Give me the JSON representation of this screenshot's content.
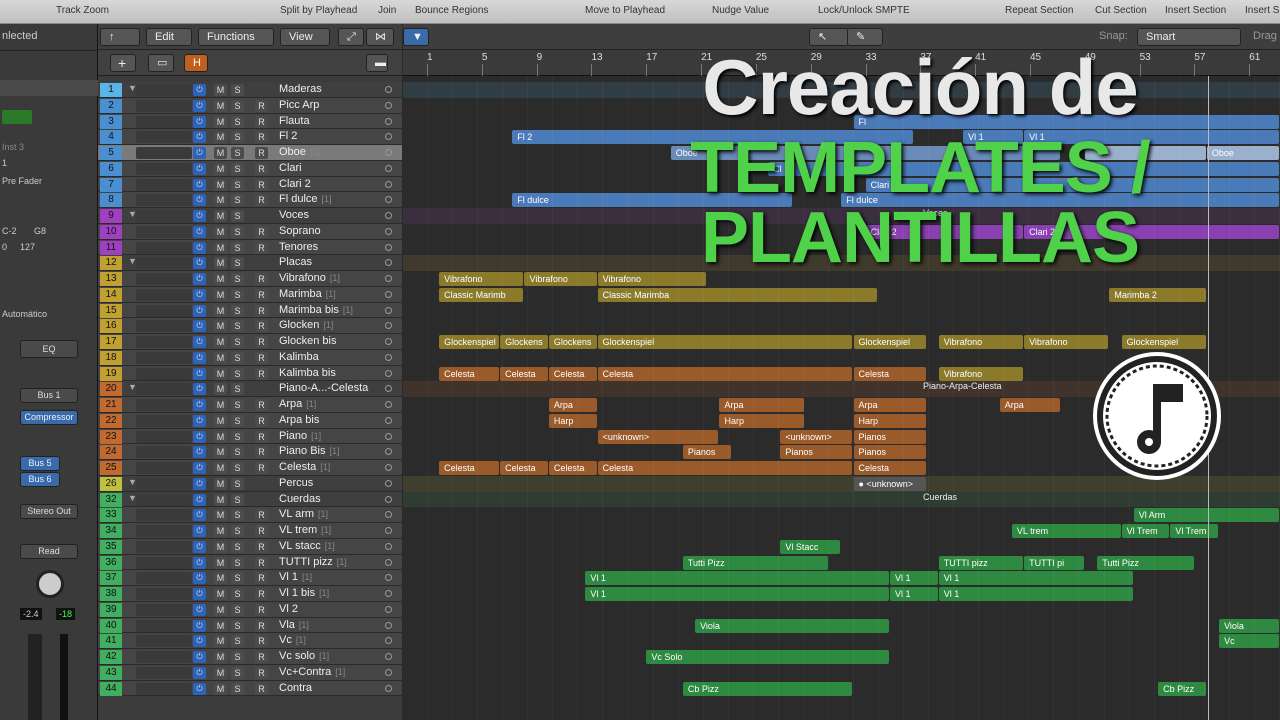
{
  "topbar": [
    "Track Zoom",
    "Split by Playhead",
    "Join",
    "Bounce Regions",
    "Move to Playhead",
    "Nudge Value",
    "Lock/Unlock SMPTE",
    "Repeat Section",
    "Cut Section",
    "Insert Section",
    "Insert Si"
  ],
  "inspector": {
    "selected": "nlected",
    "inst": "Inst 3",
    "fader": "Pre Fader",
    "key_lo": "C-2",
    "key_hi": "G8",
    "vel_lo": "0",
    "vel_hi": "127",
    "auto": "Automático",
    "eq": "EQ",
    "bus1": "Bus 1",
    "compressor": "Compressor",
    "bus5": "Bus 5",
    "bus6": "Bus 6",
    "stereo": "Stereo Out",
    "read": "Read",
    "val1": "-2.4",
    "val2": "-18"
  },
  "toolbar": {
    "edit": "Edit",
    "functions": "Functions",
    "view": "View",
    "snap_label": "Snap:",
    "snap_value": "Smart",
    "drag": "Drag"
  },
  "ruler": [
    "1",
    "5",
    "9",
    "13",
    "17",
    "21",
    "25",
    "29",
    "33",
    "37",
    "41",
    "45",
    "49",
    "53",
    "57",
    "61"
  ],
  "tracks": [
    {
      "n": "1",
      "name": "Maderas",
      "folder": true,
      "color": "#5ab4e6"
    },
    {
      "n": "2",
      "name": "Picc Arp",
      "color": "#4a90d0"
    },
    {
      "n": "3",
      "name": "Flauta",
      "color": "#4a90d0"
    },
    {
      "n": "4",
      "name": "Fl 2",
      "color": "#4a90d0"
    },
    {
      "n": "5",
      "name": "Oboe",
      "cnt": "[1]",
      "color": "#4a90d0",
      "sel": true
    },
    {
      "n": "6",
      "name": "Clari",
      "color": "#4a90d0"
    },
    {
      "n": "7",
      "name": "Clari 2",
      "color": "#4a90d0"
    },
    {
      "n": "8",
      "name": "Fl dulce",
      "cnt": "[1]",
      "color": "#4a90d0"
    },
    {
      "n": "9",
      "name": "Voces",
      "folder": true,
      "color": "#a040c0"
    },
    {
      "n": "10",
      "name": "Soprano",
      "color": "#a040c0"
    },
    {
      "n": "11",
      "name": "Tenores",
      "color": "#a040c0"
    },
    {
      "n": "12",
      "name": "Placas",
      "folder": true,
      "color": "#c0a030"
    },
    {
      "n": "13",
      "name": "Vibrafono",
      "cnt": "[1]",
      "color": "#c0a030"
    },
    {
      "n": "14",
      "name": "Marimba",
      "cnt": "[1]",
      "color": "#c0a030"
    },
    {
      "n": "15",
      "name": "Marimba bis",
      "cnt": "[1]",
      "color": "#c0a030"
    },
    {
      "n": "16",
      "name": "Glocken",
      "cnt": "[1]",
      "color": "#c0a030"
    },
    {
      "n": "17",
      "name": "Glocken bis",
      "color": "#c0a030"
    },
    {
      "n": "18",
      "name": "Kalimba",
      "color": "#c0a030"
    },
    {
      "n": "19",
      "name": "Kalimba bis",
      "color": "#c0a030"
    },
    {
      "n": "20",
      "name": "Piano-A...-Celesta",
      "folder": true,
      "color": "#c06a30"
    },
    {
      "n": "21",
      "name": "Arpa",
      "cnt": "[1]",
      "color": "#c06a30"
    },
    {
      "n": "22",
      "name": "Arpa bis",
      "color": "#c06a30"
    },
    {
      "n": "23",
      "name": "Piano",
      "cnt": "[1]",
      "color": "#c06a30"
    },
    {
      "n": "24",
      "name": "Piano Bis",
      "cnt": "[1]",
      "color": "#c06a30"
    },
    {
      "n": "25",
      "name": "Celesta",
      "cnt": "[1]",
      "color": "#c06a30"
    },
    {
      "n": "26",
      "name": "Percus",
      "folder": true,
      "color": "#c0c040"
    },
    {
      "n": "32",
      "name": "Cuerdas",
      "folder": true,
      "color": "#40b060"
    },
    {
      "n": "33",
      "name": "VL arm",
      "cnt": "[1]",
      "color": "#40b060"
    },
    {
      "n": "34",
      "name": "VL trem",
      "cnt": "[1]",
      "color": "#40b060"
    },
    {
      "n": "35",
      "name": "VL stacc",
      "cnt": "[1]",
      "color": "#40b060"
    },
    {
      "n": "36",
      "name": "TUTTI pizz",
      "cnt": "[1]",
      "color": "#40b060"
    },
    {
      "n": "37",
      "name": "Vl 1",
      "cnt": "[1]",
      "color": "#40b060"
    },
    {
      "n": "38",
      "name": "Vl 1 bis",
      "cnt": "[1]",
      "color": "#40b060"
    },
    {
      "n": "39",
      "name": "Vl 2",
      "color": "#40b060"
    },
    {
      "n": "40",
      "name": "Vla",
      "cnt": "[1]",
      "color": "#40b060"
    },
    {
      "n": "41",
      "name": "Vc",
      "cnt": "[1]",
      "color": "#40b060"
    },
    {
      "n": "42",
      "name": "Vc solo",
      "cnt": "[1]",
      "color": "#40b060"
    },
    {
      "n": "43",
      "name": "Vc+Contra",
      "cnt": "[1]",
      "color": "#40b060"
    },
    {
      "n": "44",
      "name": "Contra",
      "color": "#40b060"
    }
  ],
  "regions": [
    {
      "row": 2,
      "s": 35,
      "e": 70,
      "label": "Fl",
      "c": "#4a7ab8"
    },
    {
      "row": 3,
      "s": 7,
      "e": 40,
      "label": "Fl 2",
      "c": "#4a7ab8"
    },
    {
      "row": 3,
      "s": 44,
      "e": 49,
      "label": "Vl 1",
      "c": "#4a7ab8"
    },
    {
      "row": 3,
      "s": 49,
      "e": 70,
      "label": "Vl 1",
      "c": "#4a7ab8"
    },
    {
      "row": 4,
      "s": 20,
      "e": 52,
      "label": "Oboe",
      "c": "#6a8ab8"
    },
    {
      "row": 4,
      "s": 54,
      "e": 64,
      "label": "",
      "c": "#9ab0cc"
    },
    {
      "row": 4,
      "s": 64,
      "e": 70,
      "label": "Oboe",
      "c": "#9ab0cc"
    },
    {
      "row": 5,
      "s": 28,
      "e": 70,
      "label": "Cl",
      "c": "#4a7ab8"
    },
    {
      "row": 6,
      "s": 36,
      "e": 70,
      "label": "Clari 2",
      "c": "#4a7ab8"
    },
    {
      "row": 7,
      "s": 7,
      "e": 30,
      "label": "Fl dulce",
      "c": "#4a7ab8"
    },
    {
      "row": 7,
      "s": 34,
      "e": 70,
      "label": "Fl dulce",
      "c": "#4a7ab8"
    },
    {
      "row": 9,
      "s": 36,
      "e": 49,
      "label": "Clari 2",
      "c": "#8a40b0"
    },
    {
      "row": 9,
      "s": 49,
      "e": 70,
      "label": "Clari 2",
      "c": "#8a40b0"
    },
    {
      "row": 12,
      "s": 1,
      "e": 8,
      "label": "Vibrafono",
      "c": "#8a7a2a"
    },
    {
      "row": 12,
      "s": 8,
      "e": 14,
      "label": "Vibrafono",
      "c": "#8a7a2a"
    },
    {
      "row": 12,
      "s": 14,
      "e": 23,
      "label": "Vibrafono",
      "c": "#8a7a2a"
    },
    {
      "row": 13,
      "s": 1,
      "e": 8,
      "label": "Classic Marimb",
      "c": "#8a7a2a"
    },
    {
      "row": 13,
      "s": 14,
      "e": 37,
      "label": "Classic Marimba",
      "c": "#8a7a2a"
    },
    {
      "row": 13,
      "s": 56,
      "e": 64,
      "label": "Marimba 2",
      "c": "#8a7a2a"
    },
    {
      "row": 16,
      "s": 1,
      "e": 6,
      "label": "Glockenspiel",
      "c": "#8a7a2a"
    },
    {
      "row": 16,
      "s": 6,
      "e": 10,
      "label": "Glockens",
      "c": "#8a7a2a"
    },
    {
      "row": 16,
      "s": 10,
      "e": 14,
      "label": "Glockens",
      "c": "#8a7a2a"
    },
    {
      "row": 16,
      "s": 14,
      "e": 35,
      "label": "Glockenspiel",
      "c": "#8a7a2a"
    },
    {
      "row": 16,
      "s": 35,
      "e": 41,
      "label": "Glockenspiel",
      "c": "#8a7a2a"
    },
    {
      "row": 16,
      "s": 42,
      "e": 49,
      "label": "Vibrafono",
      "c": "#8a7a2a"
    },
    {
      "row": 16,
      "s": 49,
      "e": 56,
      "label": "Vibrafono",
      "c": "#8a7a2a"
    },
    {
      "row": 16,
      "s": 57,
      "e": 64,
      "label": "Glockenspiel",
      "c": "#8a7a2a"
    },
    {
      "row": 18,
      "s": 1,
      "e": 6,
      "label": "Celesta",
      "c": "#9a5a2a"
    },
    {
      "row": 18,
      "s": 6,
      "e": 10,
      "label": "Celesta",
      "c": "#9a5a2a"
    },
    {
      "row": 18,
      "s": 10,
      "e": 14,
      "label": "Celesta",
      "c": "#9a5a2a"
    },
    {
      "row": 18,
      "s": 14,
      "e": 35,
      "label": "Celesta",
      "c": "#9a5a2a"
    },
    {
      "row": 18,
      "s": 35,
      "e": 41,
      "label": "Celesta",
      "c": "#9a5a2a"
    },
    {
      "row": 18,
      "s": 42,
      "e": 49,
      "label": "Vibrafono",
      "c": "#8a7a2a"
    },
    {
      "row": 20,
      "s": 10,
      "e": 14,
      "label": "Arpa",
      "c": "#9a5a2a"
    },
    {
      "row": 20,
      "s": 24,
      "e": 31,
      "label": "Arpa",
      "c": "#9a5a2a"
    },
    {
      "row": 20,
      "s": 35,
      "e": 41,
      "label": "Arpa",
      "c": "#9a5a2a"
    },
    {
      "row": 20,
      "s": 47,
      "e": 52,
      "label": "Arpa",
      "c": "#9a5a2a"
    },
    {
      "row": 20,
      "s": 60,
      "e": 64,
      "label": "Arpa",
      "c": "#9a5a2a"
    },
    {
      "row": 21,
      "s": 10,
      "e": 14,
      "label": "Harp",
      "c": "#9a5a2a"
    },
    {
      "row": 21,
      "s": 24,
      "e": 31,
      "label": "Harp",
      "c": "#9a5a2a"
    },
    {
      "row": 21,
      "s": 35,
      "e": 41,
      "label": "Harp",
      "c": "#9a5a2a"
    },
    {
      "row": 22,
      "s": 14,
      "e": 24,
      "label": "<unknown>",
      "c": "#9a5a2a"
    },
    {
      "row": 22,
      "s": 29,
      "e": 35,
      "label": "<unknown>",
      "c": "#9a5a2a"
    },
    {
      "row": 22,
      "s": 35,
      "e": 41,
      "label": "Pianos",
      "c": "#9a5a2a"
    },
    {
      "row": 23,
      "s": 21,
      "e": 25,
      "label": "Pianos",
      "c": "#9a5a2a"
    },
    {
      "row": 23,
      "s": 29,
      "e": 35,
      "label": "Pianos",
      "c": "#9a5a2a"
    },
    {
      "row": 23,
      "s": 35,
      "e": 41,
      "label": "Pianos",
      "c": "#9a5a2a"
    },
    {
      "row": 24,
      "s": 1,
      "e": 6,
      "label": "Celesta",
      "c": "#9a5a2a"
    },
    {
      "row": 24,
      "s": 6,
      "e": 10,
      "label": "Celesta",
      "c": "#9a5a2a"
    },
    {
      "row": 24,
      "s": 10,
      "e": 14,
      "label": "Celesta",
      "c": "#9a5a2a"
    },
    {
      "row": 24,
      "s": 14,
      "e": 35,
      "label": "Celesta",
      "c": "#9a5a2a"
    },
    {
      "row": 24,
      "s": 35,
      "e": 41,
      "label": "Celesta",
      "c": "#9a5a2a"
    },
    {
      "row": 25,
      "s": 35,
      "e": 41,
      "label": "● <unknown>",
      "c": "#555555"
    },
    {
      "row": 27,
      "s": 58,
      "e": 70,
      "label": "Vl Arm",
      "c": "#2e8a40"
    },
    {
      "row": 28,
      "s": 48,
      "e": 57,
      "label": "VL trem",
      "c": "#2e8a40"
    },
    {
      "row": 28,
      "s": 57,
      "e": 61,
      "label": "Vl Trem",
      "c": "#2e8a40"
    },
    {
      "row": 28,
      "s": 61,
      "e": 65,
      "label": "Vl Trem",
      "c": "#2e8a40"
    },
    {
      "row": 29,
      "s": 29,
      "e": 34,
      "label": "Vl Stacc",
      "c": "#2e8a40"
    },
    {
      "row": 30,
      "s": 21,
      "e": 33,
      "label": "Tutti Pizz",
      "c": "#2e8a40"
    },
    {
      "row": 30,
      "s": 42,
      "e": 49,
      "label": "TUTTI pizz",
      "c": "#2e8a40"
    },
    {
      "row": 30,
      "s": 49,
      "e": 54,
      "label": "TUTTI pi",
      "c": "#2e8a40"
    },
    {
      "row": 30,
      "s": 55,
      "e": 63,
      "label": "Tutti Pizz",
      "c": "#2e8a40"
    },
    {
      "row": 31,
      "s": 13,
      "e": 38,
      "label": "Vl 1",
      "c": "#2e8a40"
    },
    {
      "row": 31,
      "s": 38,
      "e": 42,
      "label": "Vl 1",
      "c": "#2e8a40"
    },
    {
      "row": 31,
      "s": 42,
      "e": 58,
      "label": "Vl 1",
      "c": "#2e8a40"
    },
    {
      "row": 32,
      "s": 13,
      "e": 38,
      "label": "Vl 1",
      "c": "#2e8a40"
    },
    {
      "row": 32,
      "s": 38,
      "e": 42,
      "label": "Vl 1",
      "c": "#2e8a40"
    },
    {
      "row": 32,
      "s": 42,
      "e": 58,
      "label": "Vl 1",
      "c": "#2e8a40"
    },
    {
      "row": 34,
      "s": 22,
      "e": 38,
      "label": "Viola",
      "c": "#2e8a40"
    },
    {
      "row": 34,
      "s": 65,
      "e": 70,
      "label": "Viola",
      "c": "#2e8a40"
    },
    {
      "row": 35,
      "s": 65,
      "e": 70,
      "label": "Vc",
      "c": "#2e8a40"
    },
    {
      "row": 36,
      "s": 18,
      "e": 38,
      "label": "Vc Solo",
      "c": "#2e8a40"
    },
    {
      "row": 38,
      "s": 21,
      "e": 35,
      "label": "Cb Pizz",
      "c": "#2e8a40"
    },
    {
      "row": 38,
      "s": 60,
      "e": 64,
      "label": "Cb Pizz",
      "c": "#2e8a40"
    }
  ],
  "folder_labels": [
    {
      "row": 8,
      "label": "Voces"
    },
    {
      "row": 19,
      "label": "Piano-Arpa-Celesta"
    },
    {
      "row": 26,
      "label": "Cuerdas"
    }
  ],
  "overlay": {
    "line1": "Creación de",
    "line2": "TEMPLATES /",
    "line3": "PLANTILLAS"
  }
}
